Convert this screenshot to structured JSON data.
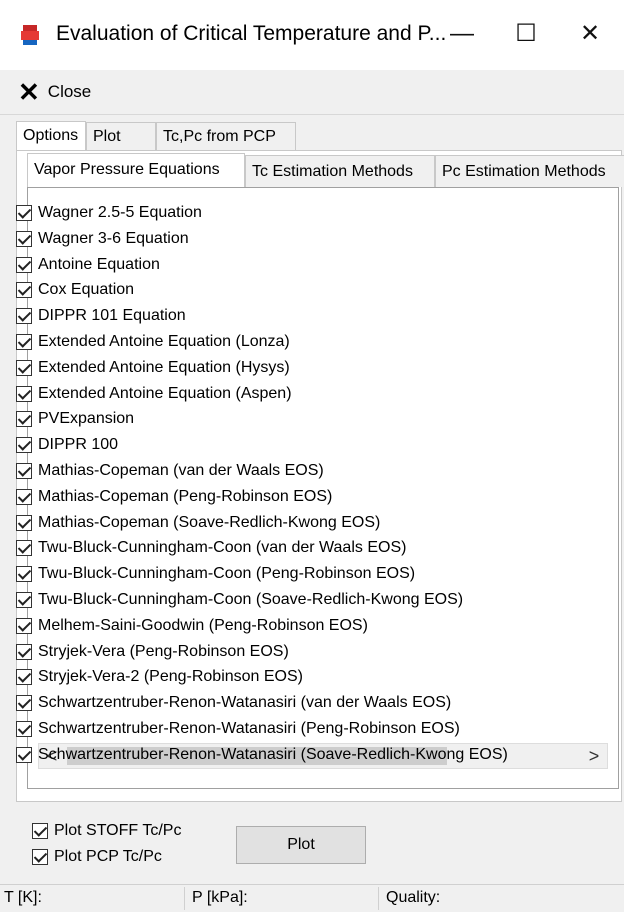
{
  "window": {
    "title": "Evaluation of Critical Temperature and P...",
    "minimize": "—",
    "maximize": "☐",
    "close": "✕"
  },
  "toolbar": {
    "close_label": "Close"
  },
  "tabs": [
    "Options",
    "Plot",
    "Tc,Pc from PCP"
  ],
  "subtabs": [
    "Vapor Pressure Equations",
    "Tc Estimation Methods",
    "Pc Estimation Methods"
  ],
  "equations": [
    "Wagner 2.5-5 Equation",
    "Wagner 3-6 Equation",
    "Antoine Equation",
    "Cox Equation",
    "DIPPR 101 Equation",
    "Extended Antoine Equation (Lonza)",
    "Extended Antoine Equation (Hysys)",
    "Extended Antoine Equation (Aspen)",
    "PVExpansion",
    "DIPPR 100",
    "Mathias-Copeman (van der Waals EOS)",
    "Mathias-Copeman (Peng-Robinson EOS)",
    "Mathias-Copeman (Soave-Redlich-Kwong EOS)",
    "Twu-Bluck-Cunningham-Coon (van der Waals EOS)",
    "Twu-Bluck-Cunningham-Coon (Peng-Robinson EOS)",
    "Twu-Bluck-Cunningham-Coon (Soave-Redlich-Kwong EOS)",
    "Melhem-Saini-Goodwin (Peng-Robinson EOS)",
    "Stryjek-Vera (Peng-Robinson EOS)",
    "Stryjek-Vera-2 (Peng-Robinson EOS)",
    "Schwartzentruber-Renon-Watanasiri (van der Waals EOS)",
    "Schwartzentruber-Renon-Watanasiri (Peng-Robinson EOS)",
    "Schwartzentruber-Renon-Watanasiri (Soave-Redlich-Kwong EOS)"
  ],
  "scroll": {
    "left": "<",
    "right": ">"
  },
  "options": {
    "plot_stoff": "Plot STOFF Tc/Pc",
    "plot_pcp": "Plot PCP Tc/Pc",
    "plot_button": "Plot"
  },
  "status": {
    "t": "T [K]:",
    "p": "P [kPa]:",
    "quality": "Quality:"
  }
}
